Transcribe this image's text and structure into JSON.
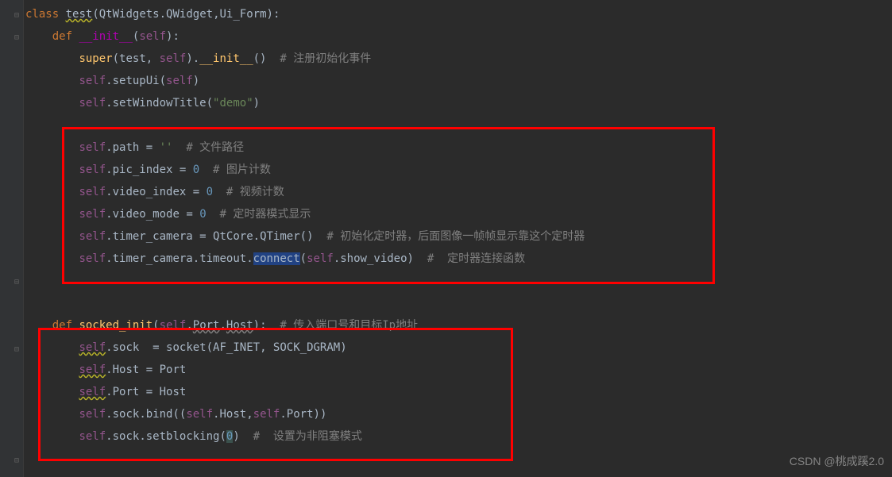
{
  "code": {
    "l1_kw_class": "class",
    "l1_name": "test",
    "l1_base1": "QtWidgets",
    "l1_base2": "QWidget",
    "l1_base3": "Ui_Form",
    "l2_kw_def": "def",
    "l2_fn": "__init__",
    "l2_self": "self",
    "l3_super": "super",
    "l3_test": "test",
    "l3_self": "self",
    "l3_init": "__init__",
    "l3_cmt": "# 注册初始化事件",
    "l4_self": "self",
    "l4_setup": "setupUi",
    "l4_arg": "self",
    "l5_self": "self",
    "l5_fn": "setWindowTitle",
    "l5_str": "\"demo\"",
    "l7_self": "self",
    "l7_attr": "path",
    "l7_str": "''",
    "l7_cmt": "# 文件路径",
    "l8_self": "self",
    "l8_attr": "pic_index",
    "l8_num": "0",
    "l8_cmt": "# 图片计数",
    "l9_self": "self",
    "l9_attr": "video_index",
    "l9_num": "0",
    "l9_cmt": "# 视频计数",
    "l10_self": "self",
    "l10_attr": "video_mode",
    "l10_num": "0",
    "l10_cmt": "# 定时器模式显示",
    "l11_self": "self",
    "l11_attr": "timer_camera",
    "l11_q1": "QtCore",
    "l11_q2": "QTimer",
    "l11_cmt": "# 初始化定时器，后面图像一帧帧显示靠这个定时器",
    "l12_self": "self",
    "l12_attr": "timer_camera",
    "l12_to": "timeout",
    "l12_conn": "connect",
    "l12_self2": "self",
    "l12_sv": "show_video",
    "l12_cmt": "#  定时器连接函数",
    "l15_kw_def": "def",
    "l15_fn": "socked_init",
    "l15_self": "self",
    "l15_p1": "Port",
    "l15_p2": "Host",
    "l15_cmt": "# 传入端口号和目标Ip地址",
    "l16_self": "self",
    "l16_sock": "sock",
    "l16_socket": "socket",
    "l16_af": "AF_INET",
    "l16_dg": "SOCK_DGRAM",
    "l17_self": "self",
    "l17_host": "Host",
    "l17_val": "Port",
    "l18_self": "self",
    "l18_port": "Port",
    "l18_val": "Host",
    "l19_self": "self",
    "l19_sock": "sock",
    "l19_bind": "bind",
    "l19_s2": "self",
    "l19_h": "Host",
    "l19_s3": "self",
    "l19_p": "Port",
    "l20_self": "self",
    "l20_sock": "sock",
    "l20_sb": "setblocking",
    "l20_num": "0",
    "l20_cmt": "#  设置为非阻塞模式"
  },
  "watermark": "CSDN @桃成蹊2.0"
}
